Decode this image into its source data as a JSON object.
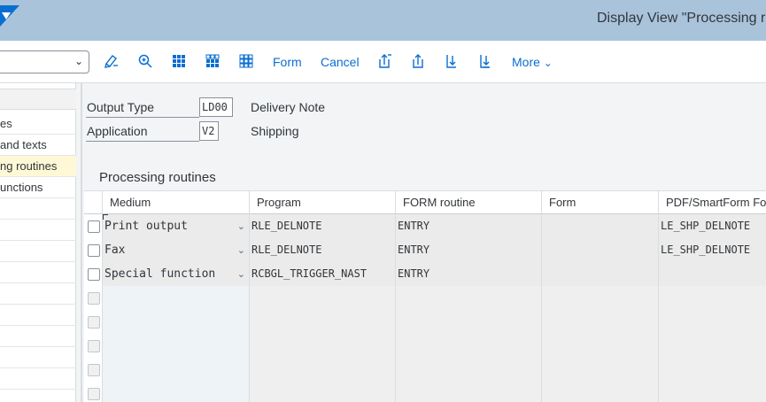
{
  "window": {
    "title": "Display View \"Processing ro"
  },
  "toolbar": {
    "dropdown_value": "",
    "buttons": [
      {
        "name": "glasses-icon",
        "label": ""
      },
      {
        "name": "find-icon",
        "label": ""
      },
      {
        "name": "select-all-icon",
        "label": ""
      },
      {
        "name": "select-block-icon",
        "label": ""
      },
      {
        "name": "deselect-all-icon",
        "label": ""
      }
    ],
    "form_label": "Form",
    "cancel_label": "Cancel",
    "more_label": "More"
  },
  "nav": {
    "items": [
      {
        "label": "es",
        "selected": false
      },
      {
        "label": "and texts",
        "selected": false
      },
      {
        "label": "ng routines",
        "selected": true
      },
      {
        "label": "unctions",
        "selected": false
      }
    ]
  },
  "header": {
    "output_type_label": "Output Type",
    "output_type_value": "LD00",
    "output_type_desc": "Delivery Note",
    "application_label": "Application",
    "application_value": "V2",
    "application_desc": "Shipping"
  },
  "section": {
    "title": "Processing routines"
  },
  "table": {
    "columns": [
      "Medium",
      "Program",
      "FORM routine",
      "Form",
      "PDF/SmartForm Fo"
    ],
    "rows": [
      {
        "medium": "Print output",
        "program": "RLE_DELNOTE",
        "form_routine": "ENTRY",
        "form": "",
        "pdf_smartform": "LE_SHP_DELNOTE"
      },
      {
        "medium": "Fax",
        "program": "RLE_DELNOTE",
        "form_routine": "ENTRY",
        "form": "",
        "pdf_smartform": "LE_SHP_DELNOTE"
      },
      {
        "medium": "Special function",
        "program": "RCBGL_TRIGGER_NAST",
        "form_routine": "ENTRY",
        "form": "",
        "pdf_smartform": ""
      }
    ]
  }
}
